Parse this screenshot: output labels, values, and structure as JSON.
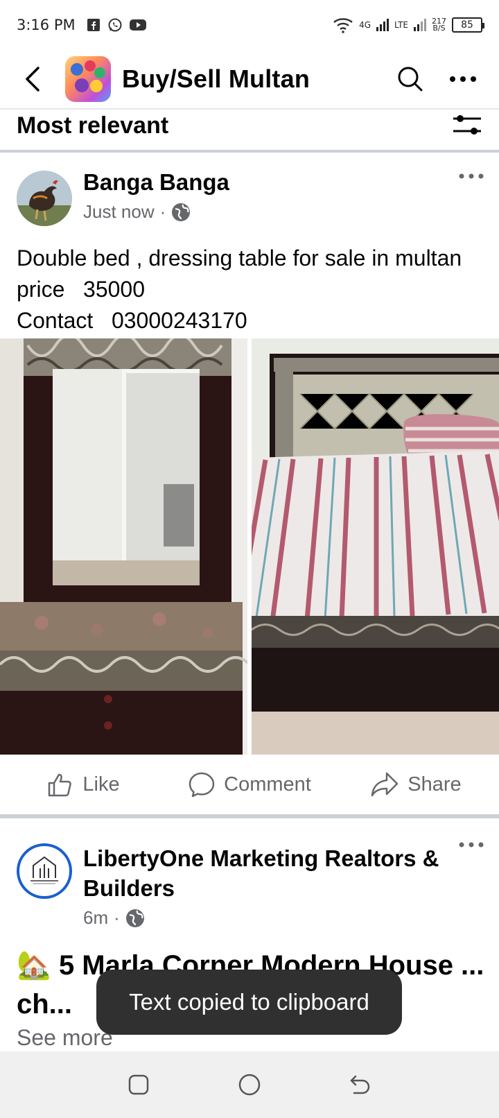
{
  "status_bar": {
    "time": "3:16 PM",
    "net_4g": "4G",
    "net_lte": "LTE",
    "speed_value": "217",
    "speed_unit": "B/S",
    "battery": "85"
  },
  "header": {
    "title": "Buy/Sell Multan"
  },
  "sort": {
    "label": "Most relevant"
  },
  "post1": {
    "author": "Banga Banga",
    "time": "Just now",
    "separator": "·",
    "text": "Double bed , dressing table for sale in multan price   35000\nContact   03000243170"
  },
  "actions": {
    "like": "Like",
    "comment": "Comment",
    "share": "Share"
  },
  "post2": {
    "author": "LibertyOne Marketing Realtors & Builders",
    "time": "6m",
    "separator": "·",
    "headline_emoji": "🏡",
    "headline": "5 Marla Corner Modern House ... ch...",
    "see_more": "See more"
  },
  "toast": {
    "message": "Text copied to clipboard"
  }
}
